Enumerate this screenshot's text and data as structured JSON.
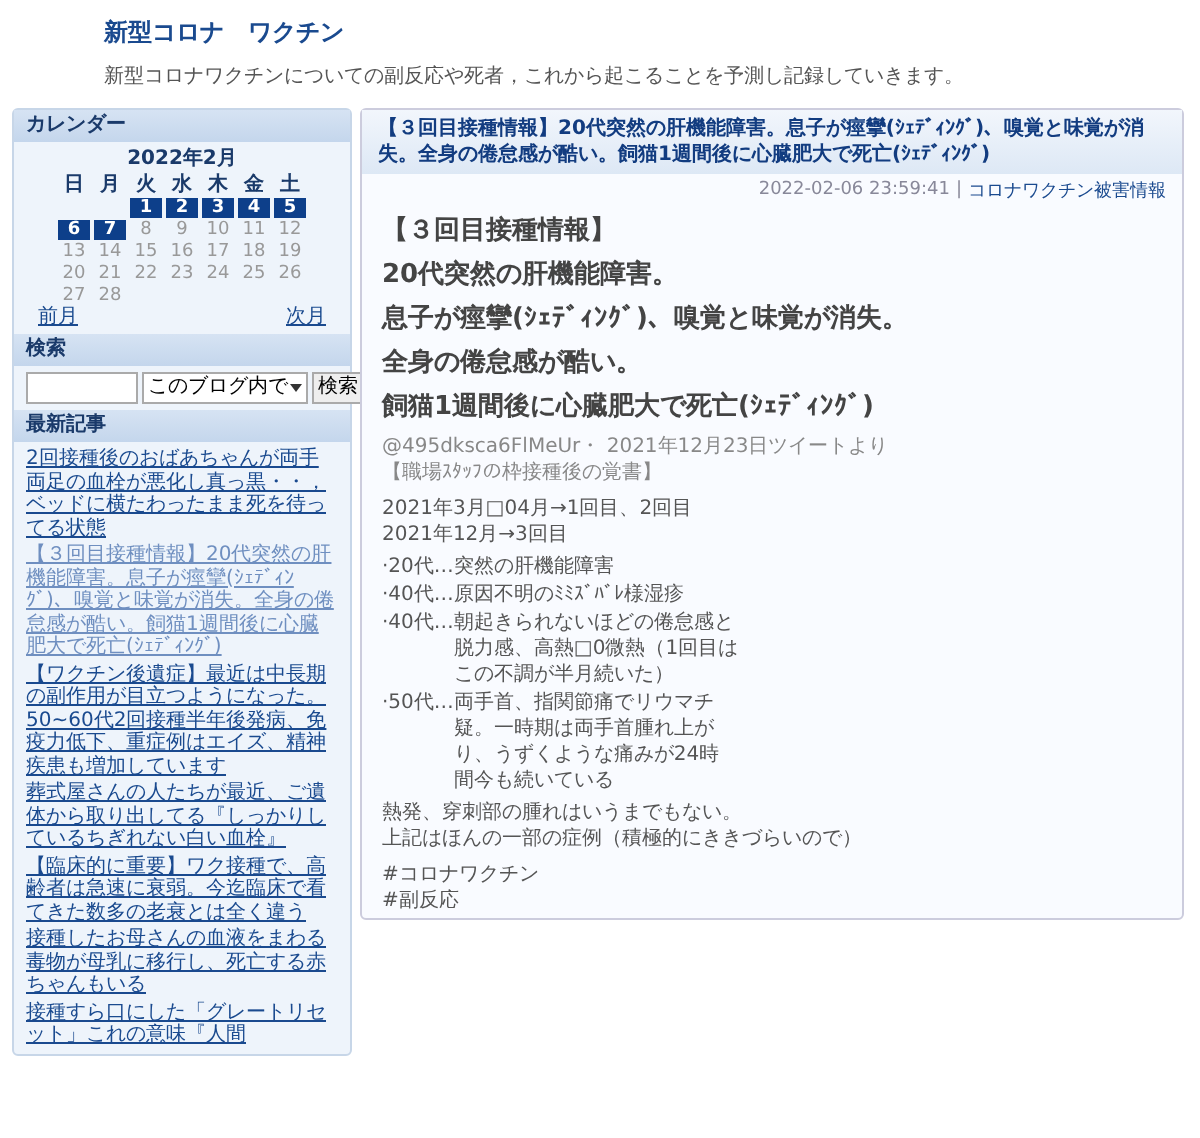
{
  "site": {
    "title": "新型コロナ　ワクチン",
    "description": "新型コロナワクチンについての副反応や死者，これから起こることを予測し記録していきます。"
  },
  "calendar": {
    "heading": "カレンダー",
    "month": "2022年2月",
    "weekdays": [
      "日",
      "月",
      "火",
      "水",
      "木",
      "金",
      "土"
    ],
    "days": [
      {
        "day": "1",
        "linked": true
      },
      {
        "day": "2",
        "linked": true
      },
      {
        "day": "3",
        "linked": true
      },
      {
        "day": "4",
        "linked": true
      },
      {
        "day": "5",
        "linked": true
      },
      {
        "day": "6",
        "linked": true
      },
      {
        "day": "7",
        "linked": true
      },
      {
        "day": "8",
        "linked": false
      },
      {
        "day": "9",
        "linked": false
      },
      {
        "day": "10",
        "linked": false
      },
      {
        "day": "11",
        "linked": false
      },
      {
        "day": "12",
        "linked": false
      },
      {
        "day": "13",
        "linked": false
      },
      {
        "day": "14",
        "linked": false
      },
      {
        "day": "15",
        "linked": false
      },
      {
        "day": "16",
        "linked": false
      },
      {
        "day": "17",
        "linked": false
      },
      {
        "day": "18",
        "linked": false
      },
      {
        "day": "19",
        "linked": false
      },
      {
        "day": "20",
        "linked": false
      },
      {
        "day": "21",
        "linked": false
      },
      {
        "day": "22",
        "linked": false
      },
      {
        "day": "23",
        "linked": false
      },
      {
        "day": "24",
        "linked": false
      },
      {
        "day": "25",
        "linked": false
      },
      {
        "day": "26",
        "linked": false
      },
      {
        "day": "27",
        "linked": false
      },
      {
        "day": "28",
        "linked": false
      }
    ],
    "prev": "前月",
    "next": "次月"
  },
  "search": {
    "heading": "検索",
    "scope": "このブログ内で",
    "button": "検索"
  },
  "recent": {
    "heading": "最新記事",
    "items": [
      {
        "text": "2回接種後のおばあちゃんが両手両足の血栓が悪化し真っ黒・・，ベッドに横たわったまま死を待ってる状態",
        "current": false
      },
      {
        "text": "【３回目接種情報】20代突然の肝機能障害。息子が痙攣(ｼｪﾃﾞｨﾝｸﾞ)、嗅覚と味覚が消失。全身の倦怠感が酷い。飼猫1週間後に心臓肥大で死亡(ｼｪﾃﾞｨﾝｸﾞ)",
        "current": true
      },
      {
        "text": "【ワクチン後遺症】最近は中長期の副作用が目立つようになった。50~60代2回接種半年後発病、免疫力低下、重症例はエイズ、精神疾患も増加しています",
        "current": false
      },
      {
        "text": "葬式屋さんの人たちが最近、ご遺体から取り出してる『しっかりしているちぎれない白い血栓』",
        "current": false
      },
      {
        "text": "【臨床的に重要】ワク接種で、高齢者は急速に衰弱。今迄臨床で看てきた数多の老衰とは全く違う",
        "current": false
      },
      {
        "text": "接種したお母さんの血液をまわる毒物が母乳に移行し、死亡する赤ちゃんもいる",
        "current": false
      },
      {
        "text": "接種すら口にした「グレートリセット」これの意味『人間",
        "current": false
      }
    ]
  },
  "article": {
    "title": "【３回目接種情報】20代突然の肝機能障害。息子が痙攣(ｼｪﾃﾞｨﾝｸﾞ)、嗅覚と味覚が消失。全身の倦怠感が酷い。飼猫1週間後に心臓肥大で死亡(ｼｪﾃﾞｨﾝｸﾞ)",
    "date": "2022-02-06 23:59:41",
    "separator": "|",
    "category": "コロナワクチン被害情報",
    "blocks": [
      {
        "kind": "heading",
        "lines": [
          "【３回目接種情報】"
        ]
      },
      {
        "kind": "heading",
        "lines": [
          "20代突然の肝機能障害。"
        ]
      },
      {
        "kind": "heading",
        "lines": [
          "息子が痙攣(ｼｪﾃﾞｨﾝｸﾞ)、嗅覚と味覚が消失。"
        ]
      },
      {
        "kind": "heading",
        "lines": [
          "全身の倦怠感が酷い。"
        ]
      },
      {
        "kind": "heading",
        "lines": [
          "飼猫1週間後に心臓肥大で死亡(ｼｪﾃﾞｨﾝｸﾞ)"
        ]
      },
      {
        "kind": "meta",
        "lines": [
          "@495dksca6FlMeUr・ 2021年12月23日ツイートより",
          "【職場ｽﾀｯﾌの枠接種後の覚書】"
        ]
      },
      {
        "kind": "para",
        "lines": [
          "2021年3月□04月→1回目、2回目",
          "2021年12月→3回目"
        ]
      },
      {
        "kind": "item",
        "lead": "·20代…",
        "lines": [
          "突然の肝機能障害"
        ]
      },
      {
        "kind": "item",
        "lead": "·40代…",
        "lines": [
          "原因不明のﾐﾐｽﾞﾊﾞﾚ様湿疹"
        ]
      },
      {
        "kind": "item",
        "lead": "·40代…",
        "lines": [
          "朝起きられないほどの倦怠感と",
          "脱力感、高熱□0微熱（1回目は",
          "この不調が半月続いた）"
        ]
      },
      {
        "kind": "item",
        "lead": "·50代…",
        "lines": [
          "両手首、指関節痛でリウマチ",
          "疑。一時期は両手首腫れ上が",
          "り、うずくような痛みが24時",
          "間今も続いている"
        ]
      },
      {
        "kind": "para",
        "lines": [
          "熱発、穿刺部の腫れはいうまでもない。",
          "上記はほんの一部の症例（積極的にききづらいので）"
        ]
      },
      {
        "kind": "para",
        "lines": [
          "#コロナワクチン",
          "#副反応"
        ]
      }
    ]
  }
}
